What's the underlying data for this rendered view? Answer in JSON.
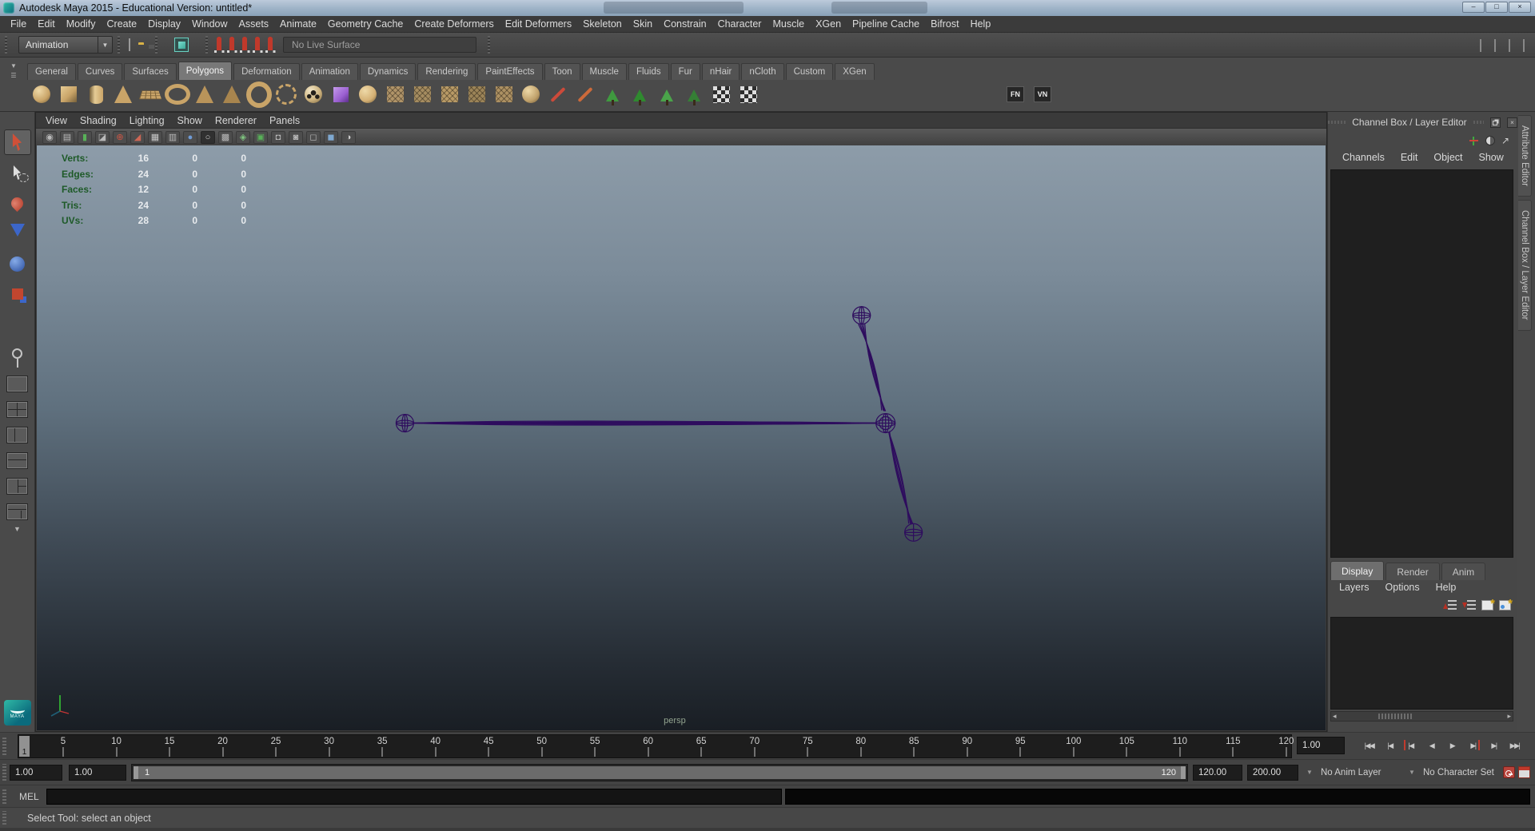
{
  "window": {
    "title": "Autodesk Maya 2015 - Educational Version: untitled*",
    "buttons": [
      {
        "name": "minimize",
        "glyph": "–"
      },
      {
        "name": "maximize",
        "glyph": "□"
      },
      {
        "name": "close",
        "glyph": "×"
      }
    ]
  },
  "menubar": {
    "items": [
      {
        "name": "file",
        "label": "File"
      },
      {
        "name": "edit",
        "label": "Edit"
      },
      {
        "name": "modify",
        "label": "Modify"
      },
      {
        "name": "create",
        "label": "Create"
      },
      {
        "name": "display",
        "label": "Display"
      },
      {
        "name": "window",
        "label": "Window"
      },
      {
        "name": "assets",
        "label": "Assets"
      },
      {
        "name": "animate",
        "label": "Animate"
      },
      {
        "name": "geometry-cache",
        "label": "Geometry Cache"
      },
      {
        "name": "create-deformers",
        "label": "Create Deformers"
      },
      {
        "name": "edit-deformers",
        "label": "Edit Deformers"
      },
      {
        "name": "skeleton",
        "label": "Skeleton"
      },
      {
        "name": "skin",
        "label": "Skin"
      },
      {
        "name": "constrain",
        "label": "Constrain"
      },
      {
        "name": "character",
        "label": "Character"
      },
      {
        "name": "muscle",
        "label": "Muscle"
      },
      {
        "name": "xgen",
        "label": "XGen"
      },
      {
        "name": "pipeline-cache",
        "label": "Pipeline Cache"
      },
      {
        "name": "bifrost",
        "label": "Bifrost"
      },
      {
        "name": "help",
        "label": "Help"
      }
    ]
  },
  "statusline": {
    "menuset": "Animation",
    "live_surface": "No Live Surface",
    "file_icons": [
      {
        "name": "new-scene",
        "cls": "ic-doc"
      },
      {
        "name": "open-scene",
        "cls": "ic-folder"
      },
      {
        "name": "save-scene",
        "cls": "ic-save"
      }
    ],
    "selection_icons": [
      {
        "name": "select-by-hierarchy",
        "cls": "ic-cursor"
      },
      {
        "name": "select-by-object-type",
        "cls": "ic-objsel",
        "active": true
      },
      {
        "name": "select-by-component-type",
        "cls": "ic-grid"
      }
    ],
    "snap_icons": [
      {
        "name": "snap-to-grids",
        "cls": "ic-magnet"
      },
      {
        "name": "snap-to-curves",
        "cls": "ic-magnet"
      },
      {
        "name": "snap-to-points",
        "cls": "ic-magnet"
      },
      {
        "name": "snap-to-projected-center",
        "cls": "ic-magnet"
      },
      {
        "name": "snap-to-view-planes",
        "cls": "ic-magnet"
      }
    ],
    "render_icons": [
      {
        "name": "render-current-frame",
        "cls": "ic-slate"
      },
      {
        "name": "ipr-render",
        "cls": "ic-mesh"
      },
      {
        "name": "render-settings",
        "cls": "ic-mesh"
      }
    ],
    "ui_toggle_icons": [
      {
        "name": "ui-toggle-1",
        "cls": "ic-panegrid"
      },
      {
        "name": "ui-toggle-2",
        "cls": "ic-panegrid"
      },
      {
        "name": "ui-toggle-3",
        "cls": "ic-panegrid"
      },
      {
        "name": "ui-toggle-4",
        "cls": "ic-panegrid"
      }
    ]
  },
  "shelf": {
    "tabs": [
      {
        "name": "general",
        "label": "General"
      },
      {
        "name": "curves",
        "label": "Curves"
      },
      {
        "name": "surfaces",
        "label": "Surfaces"
      },
      {
        "name": "polygons",
        "label": "Polygons",
        "active": true
      },
      {
        "name": "deformation",
        "label": "Deformation"
      },
      {
        "name": "animation",
        "label": "Animation"
      },
      {
        "name": "dynamics",
        "label": "Dynamics"
      },
      {
        "name": "rendering",
        "label": "Rendering"
      },
      {
        "name": "painteffects",
        "label": "PaintEffects"
      },
      {
        "name": "toon",
        "label": "Toon"
      },
      {
        "name": "muscle",
        "label": "Muscle"
      },
      {
        "name": "fluids",
        "label": "Fluids"
      },
      {
        "name": "fur",
        "label": "Fur"
      },
      {
        "name": "nhair",
        "label": "nHair"
      },
      {
        "name": "ncloth",
        "label": "nCloth"
      },
      {
        "name": "custom",
        "label": "Custom"
      },
      {
        "name": "xgen",
        "label": "XGen"
      }
    ],
    "icons": [
      {
        "name": "poly-sphere",
        "cls": "ball"
      },
      {
        "name": "poly-cube",
        "cls": "box"
      },
      {
        "name": "poly-cylinder",
        "cls": "cyl"
      },
      {
        "name": "poly-cone",
        "cls": "cone"
      },
      {
        "name": "poly-plane",
        "cls": "plane"
      },
      {
        "name": "poly-torus",
        "cls": "torus"
      },
      {
        "name": "poly-prism",
        "cls": "cone",
        "c": "#b9945a"
      },
      {
        "name": "poly-pyramid",
        "cls": "cone",
        "c": "#a8854e"
      },
      {
        "name": "poly-pipe",
        "cls": "pipe"
      },
      {
        "name": "poly-helix",
        "cls": "helix"
      },
      {
        "name": "poly-soccer-ball",
        "cls": "soccer"
      },
      {
        "name": "platonic-solid",
        "cls": "gift",
        "c": "#9a5fd0"
      },
      {
        "name": "sculpt-geometry",
        "cls": "ball",
        "c": "#d4b074"
      },
      {
        "name": "mirror-geometry",
        "cls": "mesh"
      },
      {
        "name": "combine",
        "cls": "mesh",
        "c": "#a58c60"
      },
      {
        "name": "separate",
        "cls": "mesh",
        "c": "#b89a66"
      },
      {
        "name": "extract",
        "cls": "mesh",
        "c": "#9c8458"
      },
      {
        "name": "booleans",
        "cls": "mesh",
        "c": "#ad9162"
      },
      {
        "name": "smooth",
        "cls": "ball",
        "c": "#bfa06a"
      },
      {
        "name": "reduce",
        "cls": "wand",
        "c": "#cc4a3a"
      },
      {
        "name": "paint-reduce-weights",
        "cls": "wand",
        "c": "#cc6a3a"
      },
      {
        "name": "paint-effects-tree-1",
        "cls": "tree",
        "c": "#3f9a3f"
      },
      {
        "name": "paint-effects-tree-2",
        "cls": "tree",
        "c": "#2f8a2f"
      },
      {
        "name": "paint-effects-tree-3",
        "cls": "tree",
        "c": "#4aa44a"
      },
      {
        "name": "paint-effects-tree-4",
        "cls": "tree",
        "c": "#357f35"
      },
      {
        "name": "quad-draw",
        "cls": "check"
      },
      {
        "name": "multi-cut",
        "cls": "check"
      },
      {
        "name": "face-normals",
        "cls": "txt",
        "label": "FN",
        "gap": true
      },
      {
        "name": "vertex-normals",
        "cls": "txt",
        "label": "VN"
      }
    ]
  },
  "toolbox": {
    "tools": [
      {
        "name": "select",
        "cls": "t-select",
        "active": true
      },
      {
        "name": "lasso-select",
        "cls": "t-lasso"
      },
      {
        "name": "paint-select",
        "cls": "t-paint"
      },
      {
        "name": "move",
        "cls": "t-move"
      },
      {
        "name": "rotate",
        "cls": "t-rotate"
      },
      {
        "name": "scale",
        "cls": "t-scale"
      }
    ],
    "layouts": [
      {
        "name": "single-pane-layout",
        "cls": "lay-1"
      },
      {
        "name": "four-pane-layout",
        "cls": "lay-4"
      },
      {
        "name": "two-pane-vertical-layout",
        "cls": "lay-2v"
      },
      {
        "name": "two-pane-horizontal-layout",
        "cls": "lay-2h"
      },
      {
        "name": "three-pane-layout",
        "cls": "lay-3"
      },
      {
        "name": "hypershade-persp-layout",
        "cls": "lay-h"
      }
    ],
    "logo": "MAYA"
  },
  "viewport": {
    "menus": [
      {
        "name": "view",
        "label": "View"
      },
      {
        "name": "shading",
        "label": "Shading"
      },
      {
        "name": "lighting",
        "label": "Lighting"
      },
      {
        "name": "show",
        "label": "Show"
      },
      {
        "name": "renderer",
        "label": "Renderer"
      },
      {
        "name": "panels",
        "label": "Panels"
      }
    ],
    "icons": [
      {
        "name": "tumble-camera",
        "glyph": "◉",
        "c": "#b9b9b9"
      },
      {
        "name": "camera-attributes",
        "glyph": "▤",
        "c": "#b9b9b9"
      },
      {
        "name": "bookmark",
        "glyph": "▮",
        "c": "#58b058"
      },
      {
        "name": "image-plane",
        "glyph": "◪",
        "c": "#b9b9b9"
      },
      {
        "name": "2d-pan-zoom",
        "glyph": "⊕",
        "c": "#cc5544"
      },
      {
        "name": "grease-pencil",
        "glyph": "◢",
        "c": "#cc6655"
      },
      {
        "name": "grid-toggle",
        "glyph": "▦",
        "c": "#c8c8c8"
      },
      {
        "name": "film-gate",
        "glyph": "▥",
        "c": "#b9b9b9"
      },
      {
        "name": "shaded-display",
        "glyph": "●",
        "c": "#6f9bd6"
      },
      {
        "name": "wireframe-display",
        "glyph": "○",
        "c": "#d0d0d0",
        "active": true
      },
      {
        "name": "textured-display",
        "glyph": "▩",
        "c": "#b9b9b9"
      },
      {
        "name": "use-all-lights",
        "glyph": "◈",
        "c": "#7fc37f"
      },
      {
        "name": "shadows-toggle",
        "glyph": "▣",
        "c": "#58b058"
      },
      {
        "name": "occlusion-toggle",
        "glyph": "◘",
        "c": "#b9b9b9"
      },
      {
        "name": "motion-blur-toggle",
        "glyph": "◙",
        "c": "#b9b9b9"
      },
      {
        "name": "isolate-select",
        "glyph": "◻",
        "c": "#b9b9b9"
      },
      {
        "name": "xray-toggle",
        "glyph": "◼",
        "c": "#7fa8d0"
      },
      {
        "name": "exposure-toggle",
        "glyph": "◑",
        "c": "#cfcfcf"
      }
    ],
    "hud": {
      "rows": [
        {
          "label": "Verts:",
          "v1": "16",
          "v2": "0",
          "v3": "0"
        },
        {
          "label": "Edges:",
          "v1": "24",
          "v2": "0",
          "v3": "0"
        },
        {
          "label": "Faces:",
          "v1": "12",
          "v2": "0",
          "v3": "0"
        },
        {
          "label": "Tris:",
          "v1": "24",
          "v2": "0",
          "v3": "0"
        },
        {
          "label": "UVs:",
          "v1": "28",
          "v2": "0",
          "v3": "0"
        }
      ]
    },
    "camera_label": "persp"
  },
  "channel_box": {
    "title": "Channel Box / Layer Editor",
    "menus": [
      {
        "name": "channels",
        "label": "Channels"
      },
      {
        "name": "edit",
        "label": "Edit"
      },
      {
        "name": "object",
        "label": "Object"
      },
      {
        "name": "show",
        "label": "Show"
      }
    ],
    "layer_tabs": [
      {
        "name": "display",
        "label": "Display",
        "active": true
      },
      {
        "name": "render",
        "label": "Render"
      },
      {
        "name": "anim",
        "label": "Anim"
      }
    ],
    "layer_menus": [
      {
        "name": "layers",
        "label": "Layers"
      },
      {
        "name": "options",
        "label": "Options"
      },
      {
        "name": "help",
        "label": "Help"
      }
    ]
  },
  "side_tabs": [
    {
      "name": "attribute-editor",
      "label": "Attribute Editor"
    },
    {
      "name": "channel-box-layer-editor",
      "label": "Channel Box / Layer Editor"
    }
  ],
  "timeline": {
    "ticks": [
      5,
      10,
      15,
      20,
      25,
      30,
      35,
      40,
      45,
      50,
      55,
      60,
      65,
      70,
      75,
      80,
      85,
      90,
      95,
      100,
      105,
      110,
      115,
      120
    ],
    "current_frame": "1",
    "current_time": "1.00",
    "playback": [
      {
        "name": "go-to-start",
        "glyph": "|◀◀"
      },
      {
        "name": "step-back-key",
        "glyph": "|◀"
      },
      {
        "name": "step-back-frame",
        "glyph": "|◀",
        "cls": "red-l"
      },
      {
        "name": "play-backwards",
        "glyph": "◀"
      },
      {
        "name": "play-forwards",
        "glyph": "▶"
      },
      {
        "name": "step-forward-frame",
        "glyph": "▶|",
        "cls": "red-r"
      },
      {
        "name": "step-forward-key",
        "glyph": "▶|"
      },
      {
        "name": "go-to-end",
        "glyph": "▶▶|"
      }
    ]
  },
  "range": {
    "animation_start": "1.00",
    "playback_start": "1.00",
    "range_start": "1",
    "range_end": "120",
    "playback_end": "120.00",
    "animation_end": "200.00",
    "anim_layer": "No Anim Layer",
    "character_set": "No Character Set"
  },
  "command_line": {
    "label": "MEL"
  },
  "help_line": {
    "text": "Select Tool: select an object"
  },
  "colors": {
    "accent_teal": "#4fd0c0",
    "hud_green": "#1e5a28",
    "skeleton_purple": "#2e0c5e",
    "viewport_top": "#8d9ca9",
    "viewport_bottom": "#191e24"
  }
}
